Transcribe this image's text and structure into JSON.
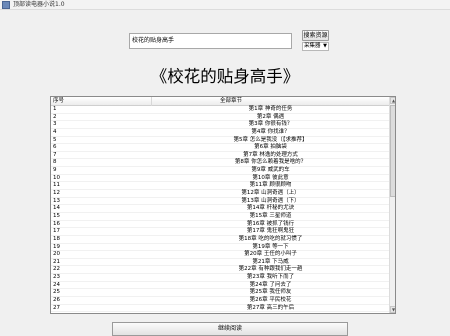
{
  "window": {
    "title": "顶部读电器小说1.0"
  },
  "search": {
    "value": "校花的贴身高手",
    "button_label": "搜索资源",
    "source_selected": "采集器"
  },
  "book": {
    "title": "《校花的贴身高手》"
  },
  "list": {
    "headers": {
      "seq": "序号",
      "chapter": "全部章节"
    },
    "rows": [
      {
        "seq": "1",
        "name": "第1章 神奇的任务"
      },
      {
        "seq": "2",
        "name": "第2章 偶遇"
      },
      {
        "seq": "3",
        "name": "第3章 你很有钱？"
      },
      {
        "seq": "4",
        "name": "第4章 你找谁？"
      },
      {
        "seq": "5",
        "name": "第5章 怎么是我没（【求推荐】"
      },
      {
        "seq": "6",
        "name": "第6章 拍脑袋"
      },
      {
        "seq": "7",
        "name": "第7章 林逸的处理方式"
      },
      {
        "seq": "8",
        "name": "第8章 你怎么赖着我是啥的？"
      },
      {
        "seq": "9",
        "name": "第9章 威武的车"
      },
      {
        "seq": "10",
        "name": "第10章 彼此意"
      },
      {
        "seq": "11",
        "name": "第11章 顾很顾吻"
      },
      {
        "seq": "12",
        "name": "第12章 山洞奇遇（上）"
      },
      {
        "seq": "13",
        "name": "第13章 山洞奇遇（下）"
      },
      {
        "seq": "14",
        "name": "第14章 杆秘的尤诀"
      },
      {
        "seq": "15",
        "name": "第15章 三星师道"
      },
      {
        "seq": "16",
        "name": "第16章 被抓了钱行"
      },
      {
        "seq": "17",
        "name": "第17章 鬼狂啊鬼狂"
      },
      {
        "seq": "18",
        "name": "第18章 吃的吃的就习惯了"
      },
      {
        "seq": "19",
        "name": "第19章 等一下"
      },
      {
        "seq": "20",
        "name": "第20章 王任的小叫子"
      },
      {
        "seq": "21",
        "name": "第21章 下马威"
      },
      {
        "seq": "22",
        "name": "第22章 有种跟我们走一趟"
      },
      {
        "seq": "23",
        "name": "第23章 我听下而了"
      },
      {
        "seq": "24",
        "name": "第24章 了问去了"
      },
      {
        "seq": "25",
        "name": "第25章 我任师友"
      },
      {
        "seq": "26",
        "name": "第26章 平民校花"
      },
      {
        "seq": "27",
        "name": "第27章 高三的午后"
      }
    ]
  },
  "footer": {
    "continue_label": "继续阅读"
  }
}
